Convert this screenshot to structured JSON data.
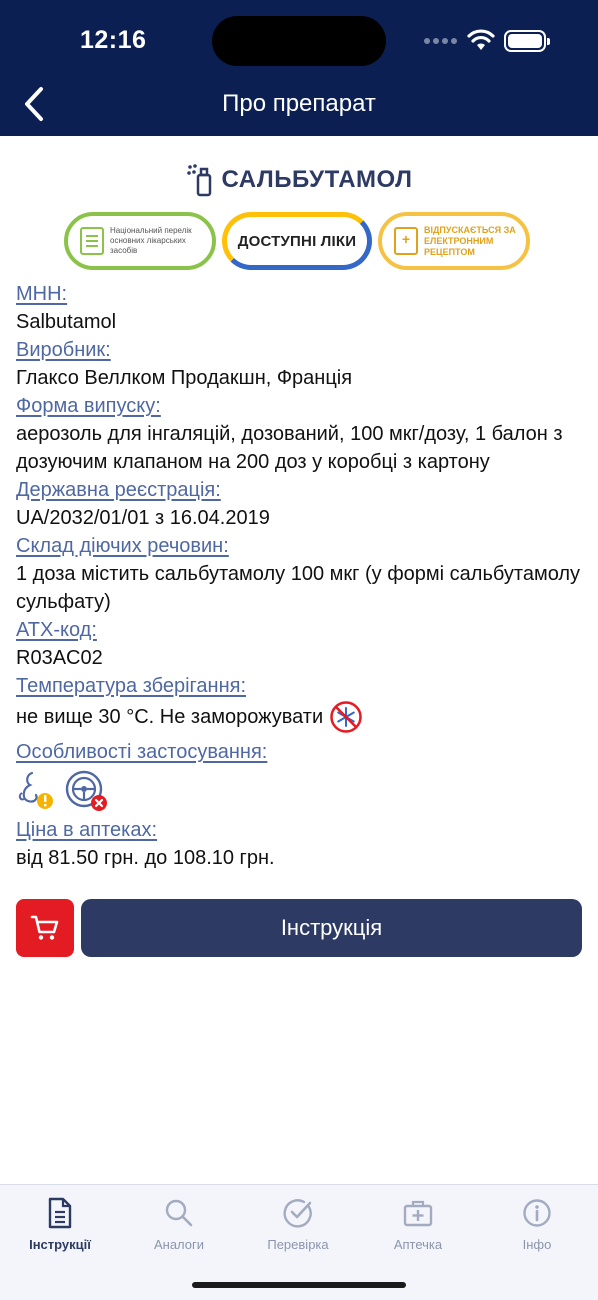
{
  "status": {
    "time": "12:16"
  },
  "nav": {
    "title": "Про препарат"
  },
  "product": {
    "name": "САЛЬБУТАМОЛ",
    "badges": {
      "national": "Національний перелік основних лікарських засобів",
      "access": "ДОСТУПНІ ЛІКИ",
      "erx": "ВІДПУСКАЄТЬСЯ ЗА ЕЛЕКТРОННИМ РЕЦЕПТОМ"
    }
  },
  "info": {
    "inn_label": "МНН:",
    "inn_value": "Salbutamol",
    "manufacturer_label": "Виробник:",
    "manufacturer_value": "Глаксо Веллком Продакшн, Франція",
    "form_label": "Форма випуску:",
    "form_value": "аерозоль для інгаляцій, дозований, 100 мкг/дозу, 1 балон з дозуючим клапаном на 200 доз у коробці з картону",
    "registration_label": "Державна реєстрація:",
    "registration_value": "UA/2032/01/01 з 16.04.2019",
    "composition_label": "Склад діючих речовин:",
    "composition_value": "1 доза містить сальбутамолу 100 мкг (у формі сальбутамолу сульфату)",
    "atc_label": "АТХ-код:",
    "atc_value": "R03AC02",
    "storage_label": "Температура зберігання:",
    "storage_value": "не вище 30 °С. Не заморожувати",
    "features_label": "Особливості застосування:",
    "price_label": "Ціна в аптеках:",
    "price_value": "від 81.50 грн. до 108.10 грн."
  },
  "actions": {
    "instruction_label": "Інструкція"
  },
  "tabs": [
    {
      "label": "Інструкції",
      "icon": "document-icon"
    },
    {
      "label": "Аналоги",
      "icon": "search-icon"
    },
    {
      "label": "Перевірка",
      "icon": "check-circle-icon"
    },
    {
      "label": "Аптечка",
      "icon": "first-aid-kit-icon"
    },
    {
      "label": "Інфо",
      "icon": "info-icon"
    }
  ],
  "colors": {
    "header_bg": "#0b1f52",
    "label": "#4f68a3",
    "primary_button": "#2d3a63",
    "cart_button": "#e31b23"
  }
}
